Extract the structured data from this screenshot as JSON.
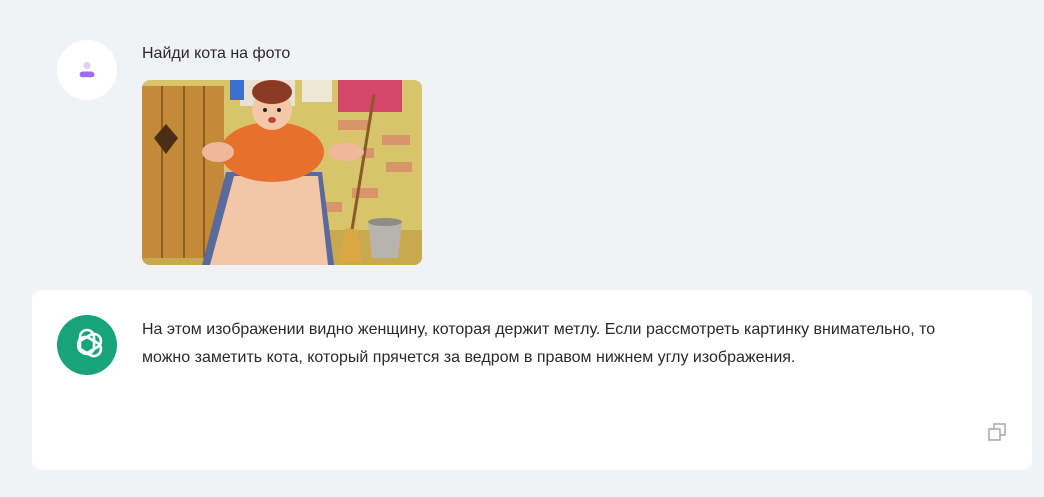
{
  "user_message": {
    "text": "Найди кота на фото",
    "avatar_icon": "user-icon",
    "attached_image_icon": "illustration-woman-with-broom"
  },
  "assistant_message": {
    "avatar_icon": "openai-logo-icon",
    "text": "На этом изображении видно женщину, которая держит метлу. Если рассмотреть картинку внимательно, то можно заметить кота, который прячется за ведром в правом нижнем углу изображения.",
    "copy_icon": "copy-icon"
  },
  "colors": {
    "background": "#f1f2f5",
    "card": "#ffffff",
    "accent_user_icon": "#8b5cf6",
    "assistant_avatar": "#19a37d"
  }
}
